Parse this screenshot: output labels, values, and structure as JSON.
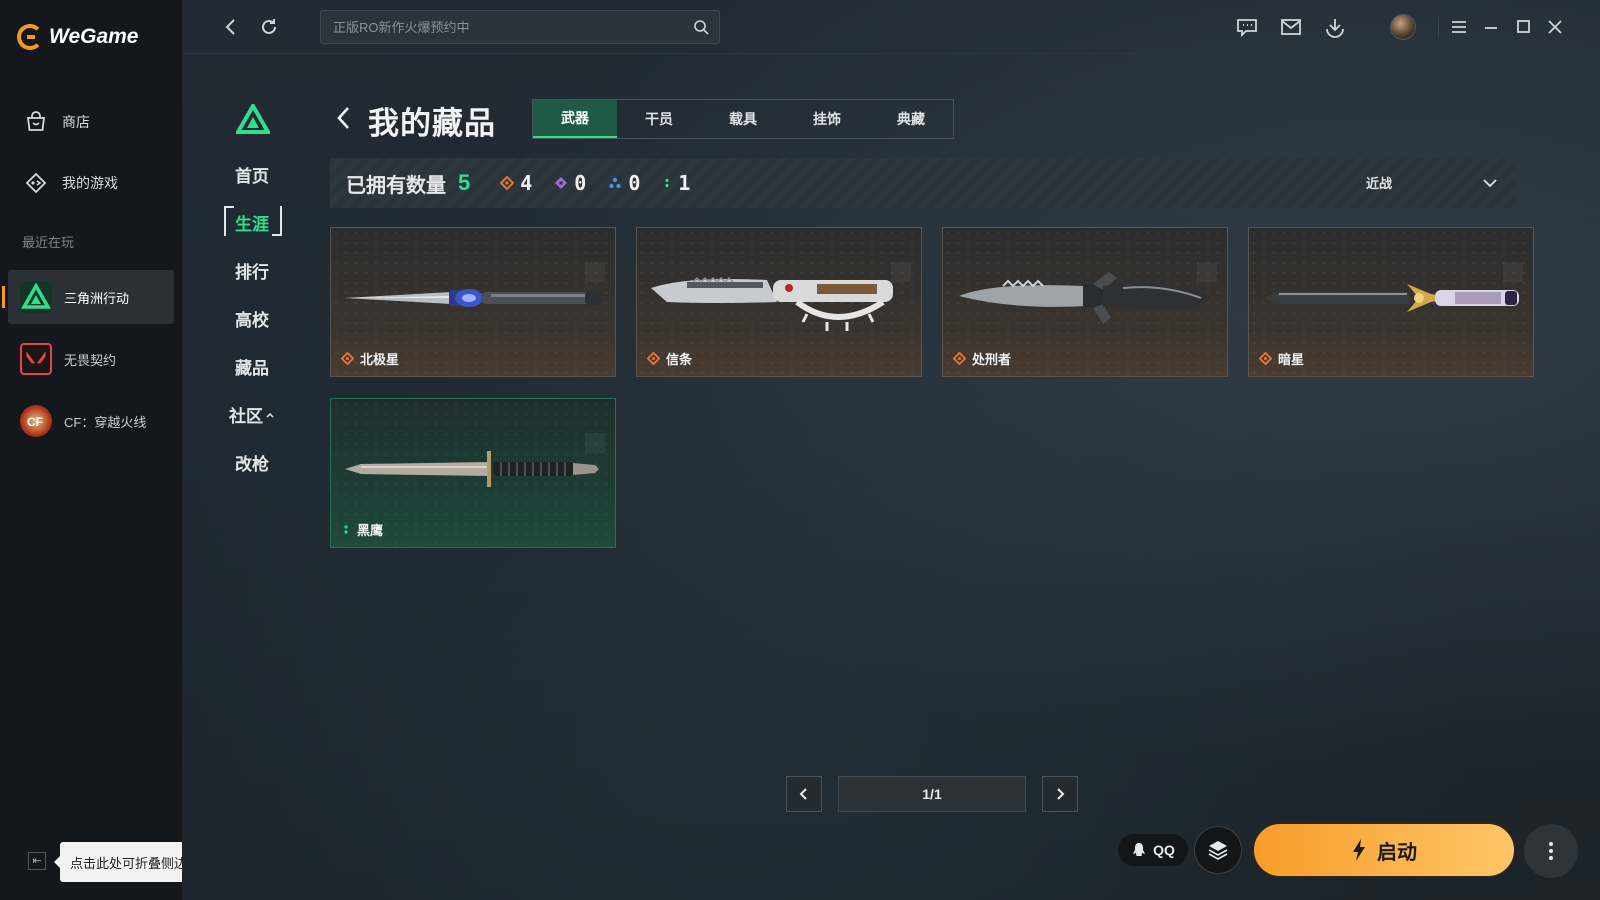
{
  "app": {
    "name": "WeGame"
  },
  "sidebar": {
    "nav": [
      {
        "label": "商店",
        "icon": "store-bag-icon"
      },
      {
        "label": "我的游戏",
        "icon": "my-games-icon"
      }
    ],
    "recent_title": "最近在玩",
    "recent": [
      {
        "label": "三角洲行动",
        "icon": "delta-force-icon",
        "active": true
      },
      {
        "label": "无畏契约",
        "icon": "valorant-icon",
        "active": false
      },
      {
        "label": "CF：穿越火线",
        "icon": "crossfire-icon",
        "active": false
      }
    ],
    "tooltip": "点击此处可折叠侧边栏"
  },
  "topbar": {
    "search_placeholder": "正版RO新作火爆预约中"
  },
  "game_nav": {
    "items": [
      {
        "label": "首页",
        "active": false
      },
      {
        "label": "生涯",
        "active": true
      },
      {
        "label": "排行",
        "active": false
      },
      {
        "label": "高校",
        "active": false
      },
      {
        "label": "藏品",
        "active": false
      },
      {
        "label": "社区",
        "active": false
      },
      {
        "label": "改枪",
        "active": false
      }
    ]
  },
  "page": {
    "title": "我的藏品",
    "tabs": [
      {
        "label": "武器",
        "active": true
      },
      {
        "label": "干员",
        "active": false
      },
      {
        "label": "载具",
        "active": false
      },
      {
        "label": "挂饰",
        "active": false
      },
      {
        "label": "典藏",
        "active": false
      }
    ],
    "owned_label": "已拥有数量",
    "owned_total": "5",
    "rarity_counts": [
      {
        "tier": "orange",
        "color": "#e8743a",
        "count": "4"
      },
      {
        "tier": "purple",
        "color": "#9b6bd6",
        "count": "0"
      },
      {
        "tier": "blue",
        "color": "#4d8fd8",
        "count": "0"
      },
      {
        "tier": "green",
        "color": "#2fe08a",
        "count": "1"
      }
    ],
    "filter_value": "近战"
  },
  "items": [
    {
      "name": "北极星",
      "rarity": "orange"
    },
    {
      "name": "信条",
      "rarity": "orange"
    },
    {
      "name": "处刑者",
      "rarity": "orange"
    },
    {
      "name": "暗星",
      "rarity": "orange"
    },
    {
      "name": "黑鹰",
      "rarity": "green"
    }
  ],
  "pagination": {
    "label": "1/1"
  },
  "footer": {
    "qq_label": "QQ",
    "launch_label": "启动"
  },
  "colors": {
    "accent_green": "#2fe08a",
    "launch_orange": "#f79c2a",
    "brand_orange": "#f59b1c"
  }
}
